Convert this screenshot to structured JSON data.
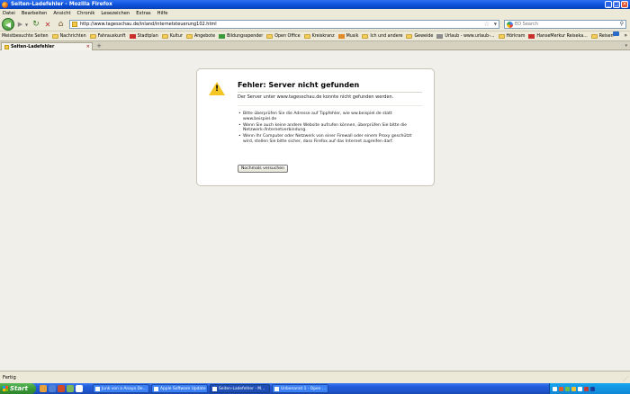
{
  "window": {
    "title": "Seiten-Ladefehler - Mozilla Firefox"
  },
  "menu": [
    "Datei",
    "Bearbeiten",
    "Ansicht",
    "Chronik",
    "Lesezeichen",
    "Extras",
    "Hilfe"
  ],
  "nav": {
    "url": "http://www.tagesschau.de/inland/internetsteuerung102.html",
    "search_placeholder": "EO Search"
  },
  "bookmarks": [
    {
      "label": "Meistbesuchte Seiten",
      "icon": "star"
    },
    {
      "label": "Nachrichten",
      "icon": "folder"
    },
    {
      "label": "Fahrauskunft",
      "icon": "folder"
    },
    {
      "label": "Stadtplan",
      "icon": "red"
    },
    {
      "label": "Kultur",
      "icon": "folder"
    },
    {
      "label": "Angebote",
      "icon": "folder"
    },
    {
      "label": "Bildungsspender",
      "icon": "green"
    },
    {
      "label": "Open Office",
      "icon": "folder"
    },
    {
      "label": "Kreiskranz",
      "icon": "folder"
    },
    {
      "label": "Musik",
      "icon": "orange"
    },
    {
      "label": "Ich und andere",
      "icon": "folder"
    },
    {
      "label": "Geweide",
      "icon": "folder"
    },
    {
      "label": "Urlaub - www.urlaub-...",
      "icon": "gray"
    },
    {
      "label": "Hörkram",
      "icon": "folder"
    },
    {
      "label": "HanseMerkur Reiseka...",
      "icon": "red"
    },
    {
      "label": "Reisen",
      "icon": "folder"
    }
  ],
  "tab": {
    "label": "Seiten-Ladefehler"
  },
  "error": {
    "title": "Fehler: Server nicht gefunden",
    "description": "Der Server unter www.tagesschau.de konnte nicht gefunden werden.",
    "bullets": [
      "Bitte überprüfen Sie die Adresse auf Tippfehler, wie ww.beispiel.de statt www.beispiel.de",
      "Wenn Sie auch keine andere Website aufrufen können, überprüfen Sie bitte die Netzwerk-/Internetverbindung.",
      "Wenn Ihr Computer oder Netzwerk von einer Firewall oder einem Proxy geschützt wird, stellen Sie bitte sicher, dass Firefox auf das Internet zugreifen darf."
    ],
    "retry_label": "Nochmals versuchen"
  },
  "status": {
    "text": "Fertig"
  },
  "taskbar": {
    "start_label": "Start",
    "tasks": [
      "Junk von a Anaya De...",
      "Apple Software Update",
      "Seiten-Ladefehler - M...",
      "Unbenannt 1 - Open ..."
    ],
    "clock": ""
  }
}
